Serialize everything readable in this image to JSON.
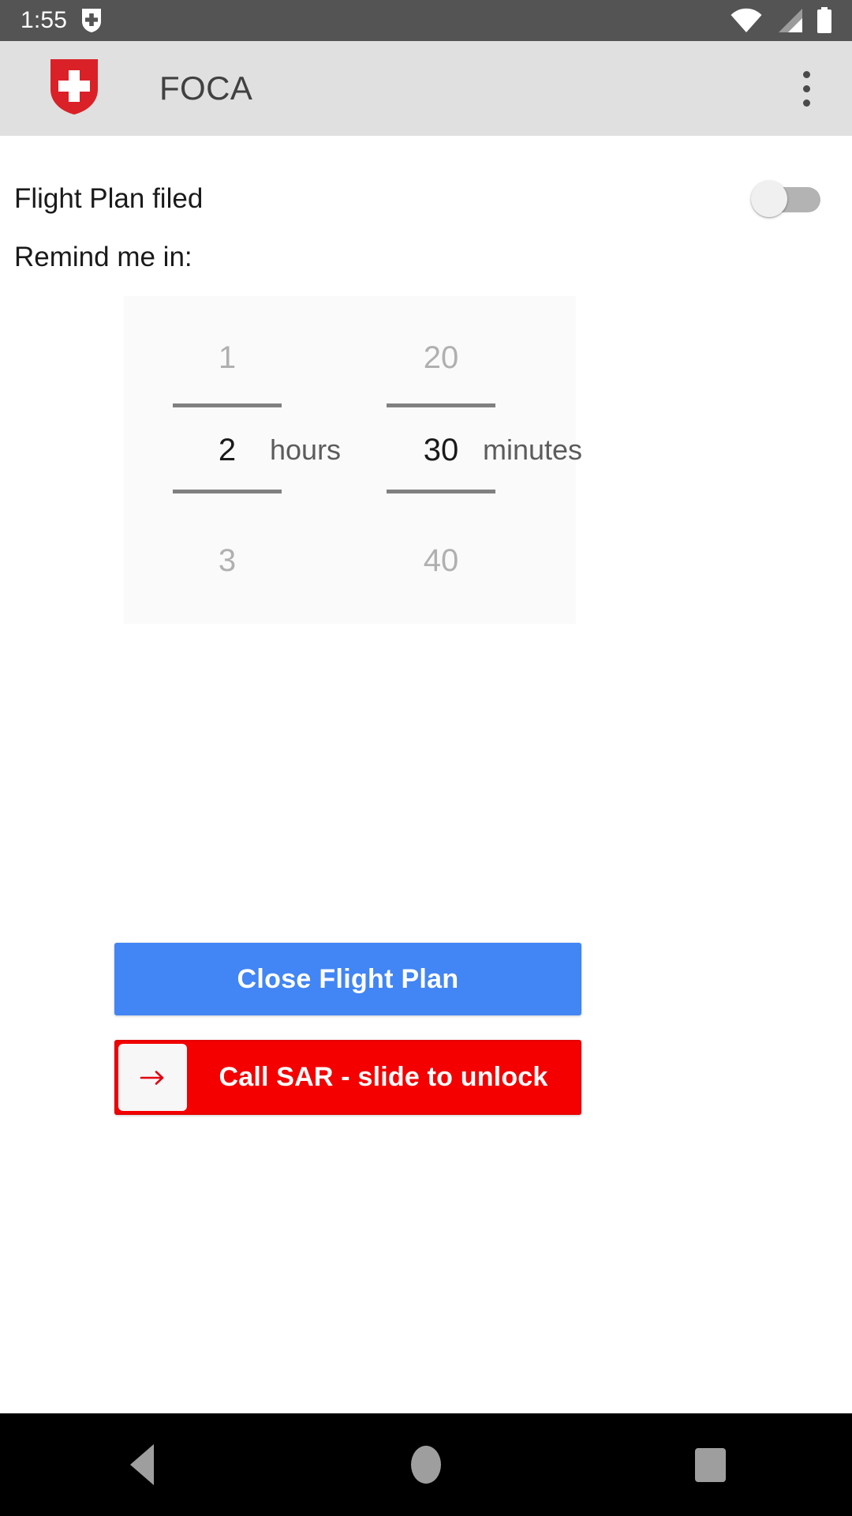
{
  "status_bar": {
    "clock": "1:55",
    "icons": {
      "notification": "swiss-shield-icon",
      "wifi": "wifi-icon",
      "signal": "cell-signal-icon",
      "battery": "battery-full-icon"
    },
    "background_color": "#545454",
    "foreground_color": "#ffffff"
  },
  "app_bar": {
    "logo": "swiss-confederation-shield-logo",
    "title": "FOCA",
    "overflow_menu": "more-options-icon",
    "background_color": "#E0E0E0",
    "title_color": "#414141"
  },
  "main": {
    "flight_plan": {
      "label": "Flight Plan filed",
      "toggle_state": "off",
      "toggle_track_color": "#b3b3b3",
      "toggle_thumb_color": "#f0f0f0"
    },
    "remind_label": "Remind me in:",
    "picker": {
      "background_color": "#FAFAFA",
      "hours": {
        "previous": "1",
        "selected": "2",
        "next": "3",
        "unit": "hours"
      },
      "minutes": {
        "previous": "20",
        "selected": "30",
        "next": "40",
        "unit": "minutes"
      },
      "selected_color": "#1a1a1a",
      "unselected_color": "#b0b0b0",
      "divider_color": "#808080"
    }
  },
  "actions": {
    "close_flight_plan": {
      "label": "Close Flight Plan",
      "background_color": "#4285F4",
      "text_color": "#ffffff"
    },
    "call_sar": {
      "label": "Call SAR - slide to unlock",
      "thumb_icon": "arrow-right-icon",
      "background_color": "#F40000",
      "thumb_color": "#F7F7F7",
      "text_color": "#ffffff"
    }
  },
  "nav_bar": {
    "back": "back-triangle-icon",
    "home": "home-circle-icon",
    "recents": "recents-square-icon",
    "background_color": "#000000",
    "icon_color": "#9e9e9e"
  }
}
